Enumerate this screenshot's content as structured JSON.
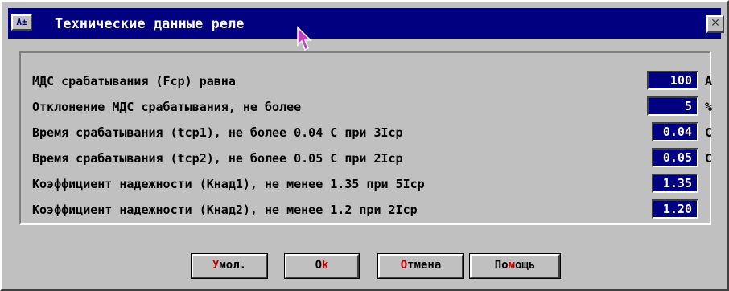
{
  "window": {
    "title": "Технические данные реле",
    "sys_menu_glyph": "A±",
    "close_glyph": "✕"
  },
  "rows": [
    {
      "label": "МДС срабатывания (Fср) равна",
      "value": "100",
      "unit": "А"
    },
    {
      "label": "Отклонение МДС срабатывания, не более",
      "value": "5",
      "unit": "%"
    },
    {
      "label": "Время срабатывания (tср1), не более 0.04 С при 3Iср",
      "value": "0.04",
      "unit": "С"
    },
    {
      "label": "Время срабатывания (tср2), не более 0.05 С при 2Iср",
      "value": "0.05",
      "unit": "С"
    },
    {
      "label": "Коэффициент надежности (Кнад1), не менее 1.35 при 5Iср",
      "value": "1.35",
      "unit": ""
    },
    {
      "label": "Коэффициент надежности (Кнад2), не менее 1.2 при 2Iср",
      "value": "1.20",
      "unit": ""
    }
  ],
  "buttons": {
    "default": {
      "hot": "У",
      "rest": "мол."
    },
    "ok": {
      "pre": "O",
      "hot": "k"
    },
    "cancel": {
      "hot": "О",
      "rest": "тмена"
    },
    "help": {
      "pre": "По",
      "hot": "м",
      "rest": "ощь"
    }
  },
  "colors": {
    "titlebar": "#000080",
    "field_bg": "#000080",
    "face": "#c0c0c0",
    "hotkey": "#c00000",
    "cursor": "#c040c0"
  },
  "icons": {
    "close": "close-icon",
    "sys_menu": "system-menu-icon",
    "cursor": "mouse-pointer-icon"
  }
}
